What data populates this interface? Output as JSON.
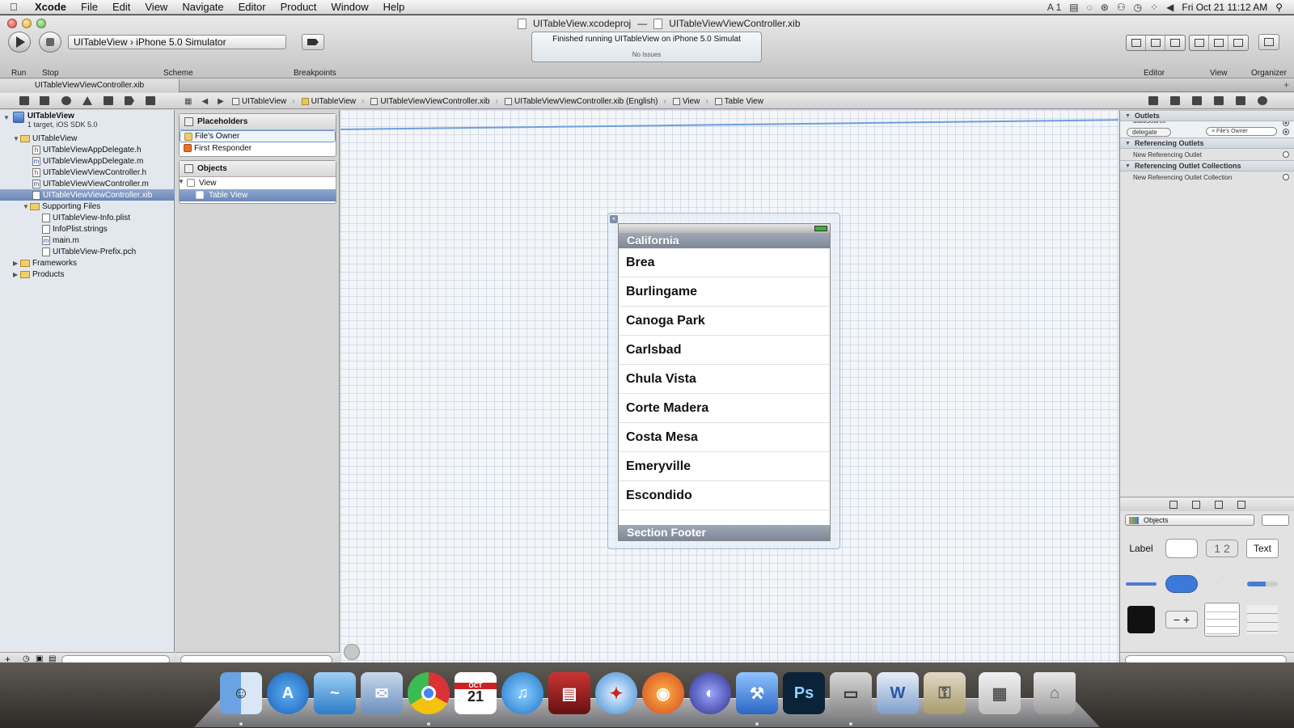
{
  "menubar": {
    "app": "Xcode",
    "items": [
      "File",
      "Edit",
      "View",
      "Navigate",
      "Editor",
      "Product",
      "Window",
      "Help"
    ],
    "status_icons": [
      "A 1",
      "▤",
      "◌",
      "⊛",
      "⚇",
      "◷",
      "⁘",
      "◀"
    ],
    "clock": "Fri Oct 21  11:12 AM"
  },
  "window": {
    "title_project": "UITableView.xcodeproj",
    "title_separator": "—",
    "title_file": "UITableViewViewController.xib"
  },
  "toolbar": {
    "run_label": "Run",
    "stop_label": "Stop",
    "scheme_label": "Scheme",
    "scheme_target": "UITableView",
    "scheme_destination": "iPhone 5.0 Simulator",
    "breakpoints_label": "Breakpoints",
    "activity_status": "Finished running UITableView on iPhone 5.0 Simulat",
    "activity_issues": "No Issues",
    "editor_label": "Editor",
    "view_label": "View",
    "organizer_label": "Organizer"
  },
  "tab": {
    "label": "UITableViewViewController.xib",
    "add": "+"
  },
  "jumpbar": {
    "crumbs": [
      "UITableView",
      "UITableView",
      "UITableViewViewController.xib",
      "UITableViewViewController.xib (English)",
      "View",
      "Table View"
    ]
  },
  "navigator": {
    "project_name": "UITableView",
    "project_sub": "1 target, iOS SDK 5.0",
    "items": [
      {
        "label": "UITableView",
        "kind": "folder"
      },
      {
        "label": "UITableViewAppDelegate.h",
        "kind": "h"
      },
      {
        "label": "UITableViewAppDelegate.m",
        "kind": "m"
      },
      {
        "label": "UITableViewViewController.h",
        "kind": "h"
      },
      {
        "label": "UITableViewViewController.m",
        "kind": "m"
      },
      {
        "label": "UITableViewViewController.xib",
        "kind": "xib",
        "selected": true
      },
      {
        "label": "Supporting Files",
        "kind": "folder"
      },
      {
        "label": "UITableView-Info.plist",
        "kind": "plist"
      },
      {
        "label": "InfoPlist.strings",
        "kind": "strings"
      },
      {
        "label": "main.m",
        "kind": "m"
      },
      {
        "label": "UITableView-Prefix.pch",
        "kind": "pch"
      },
      {
        "label": "Frameworks",
        "kind": "folder"
      },
      {
        "label": "Products",
        "kind": "folder"
      }
    ]
  },
  "outline": {
    "placeholders_title": "Placeholders",
    "files_owner": "File's Owner",
    "first_responder": "First Responder",
    "objects_title": "Objects",
    "view": "View",
    "table_view": "Table View"
  },
  "table": {
    "header": "California",
    "rows": [
      "Brea",
      "Burlingame",
      "Canoga Park",
      "Carlsbad",
      "Chula Vista",
      "Corte Madera",
      "Costa Mesa",
      "Emeryville",
      "Escondido"
    ],
    "footer": "Section Footer"
  },
  "inspector": {
    "outlets_title": "Outlets",
    "outlet_datasource": "dataSource",
    "outlet_delegate": "delegate",
    "delegate_target": "File's Owner",
    "referencing_title": "Referencing Outlets",
    "new_referencing": "New Referencing Outlet",
    "collections_title": "Referencing Outlet Collections",
    "new_collection": "New Referencing Outlet Collection"
  },
  "library": {
    "selector": "Objects",
    "label_item": "Label",
    "segmented_item": "1 2",
    "text_item": "Text",
    "stepper_item": "− +"
  },
  "dock": {
    "calendar_month": "OCT",
    "calendar_day": "21"
  },
  "colors": {
    "selection": "#6b87b8",
    "section_header": "#8a94a2",
    "connection_line": "#6e9ee0"
  }
}
